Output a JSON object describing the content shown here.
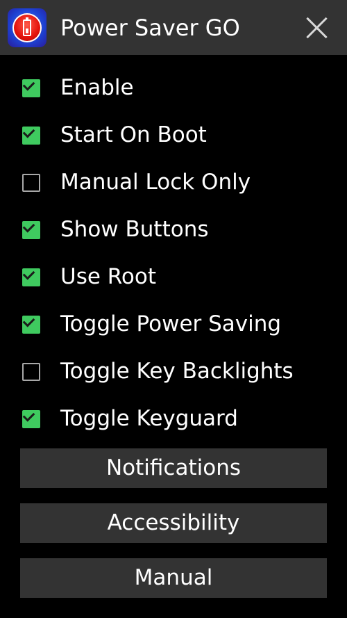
{
  "titlebar": {
    "icon": "battery-power-icon",
    "title": "Power Saver GO",
    "close_icon": "close-icon"
  },
  "colors": {
    "titlebar": "#333333",
    "background": "#000000",
    "checked": "#3fca5f",
    "unchecked_border": "#a8a8a8",
    "button": "#333333"
  },
  "options": [
    {
      "label": "Enable",
      "checked": true
    },
    {
      "label": "Start On Boot",
      "checked": true
    },
    {
      "label": "Manual Lock Only",
      "checked": false
    },
    {
      "label": "Show Buttons",
      "checked": true
    },
    {
      "label": "Use Root",
      "checked": true
    },
    {
      "label": "Toggle Power Saving",
      "checked": true
    },
    {
      "label": "Toggle Key Backlights",
      "checked": false
    },
    {
      "label": "Toggle Keyguard",
      "checked": true
    }
  ],
  "buttons": {
    "notifications": "Notifications",
    "accessibility": "Accessibility",
    "manual": "Manual"
  }
}
